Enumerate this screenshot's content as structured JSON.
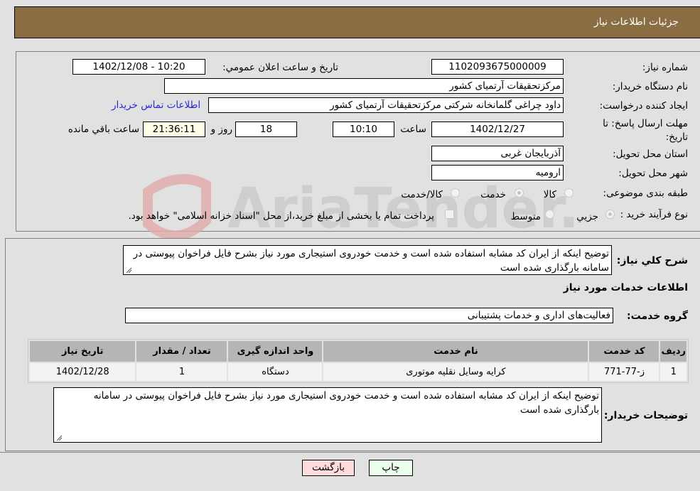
{
  "header": {
    "title": "جزئیات اطلاعات نیاز"
  },
  "form": {
    "need_number": {
      "label": "شماره نیاز:",
      "value": "1102093675000009"
    },
    "announce": {
      "label": "تاریخ و ساعت اعلان عمومي:",
      "value": "1402/12/08 - 10:20"
    },
    "buyer_org": {
      "label": "نام دستگاه خریدار:",
      "value": "مرکزتحقیقات آرتمیای کشور"
    },
    "requester": {
      "label": "ایجاد کننده درخواست:",
      "value": "داود چراغی گلمانخانه شرکتی مرکزتحقیقات آرتمیای کشور",
      "contact_link": "اطلاعات تماس خریدار"
    },
    "deadline": {
      "label": "مهلت ارسال پاسخ: تا تاریخ:",
      "date": "1402/12/27",
      "time_label": "ساعت",
      "time": "10:10",
      "days": "18",
      "days_label": "روز و",
      "remaining": "21:36:11",
      "remaining_label": "ساعت باقي مانده"
    },
    "province": {
      "label": "استان محل تحویل:",
      "value": "آذربایجان غربی"
    },
    "city": {
      "label": "شهر محل تحویل:",
      "value": "ارومیه"
    },
    "category": {
      "label": "طبقه بندی موضوعی:",
      "options": [
        "کالا",
        "خدمت",
        "کالا/خدمت"
      ],
      "selected": "خدمت"
    },
    "process": {
      "label": "نوع فرآیند خرید :",
      "options": [
        "جزيي",
        "متوسط"
      ],
      "selected": "جزيي",
      "treasury_note": "پرداخت تمام یا بخشی از مبلغ خرید،از محل \"اسناد خزانه اسلامی\" خواهد بود."
    }
  },
  "watermark": {
    "text": "AriaTender.neT"
  },
  "details": {
    "summary_label": "شرح کلي نیاز:",
    "summary": "توضیح اینکه از ایران کد مشابه استفاده شده است و خدمت خودروی استیجاری مورد نیاز بشرح فایل فراخوان پیوستی در سامانه بارگذاری شده است",
    "services_title": "اطلاعات خدمات مورد نیاز",
    "service_group_label": "گروه خدمت:",
    "service_group": "فعالیت‌های اداری و خدمات پشتیبانی",
    "table": {
      "headers": [
        "ردیف",
        "کد خدمت",
        "نام خدمت",
        "واحد اندازه گیری",
        "تعداد / مقدار",
        "تاریخ نیاز"
      ],
      "rows": [
        [
          "1",
          "ز-77-771",
          "کرایه وسایل نقلیه موتوری",
          "دستگاه",
          "1",
          "1402/12/28"
        ]
      ]
    },
    "buyer_notes_label": "توضیحات خریدار:",
    "buyer_notes": "توضیح اینکه از ایران کد مشابه استفاده شده است و خدمت خودروی استیجاری مورد نیاز بشرح فایل فراخوان پیوستی در سامانه بارگذاری شده است"
  },
  "buttons": {
    "print": "چاپ",
    "back": "بازگشت"
  }
}
